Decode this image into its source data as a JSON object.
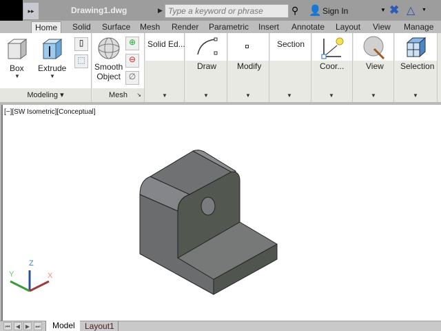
{
  "titlebar": {
    "title": "Drawing1.dwg",
    "search_placeholder": "Type a keyword or phrase",
    "sign_in": "Sign In"
  },
  "tabs": [
    "Home",
    "Solid",
    "Surface",
    "Mesh",
    "Render",
    "Parametric",
    "Insert",
    "Annotate",
    "Layout",
    "View",
    "Manage"
  ],
  "ribbon": {
    "box": "Box",
    "extrude": "Extrude",
    "smooth1": "Smooth",
    "smooth2": "Object",
    "modeling": "Modeling",
    "mesh": "Mesh",
    "solid_edit": "Solid Ed...",
    "draw": "Draw",
    "modify": "Modify",
    "section": "Section",
    "coordinates": "Coor...",
    "view": "View",
    "selection": "Selection"
  },
  "viewport": {
    "label": "[−][SW Isometric][Conceptual]",
    "axis_x": "X",
    "axis_y": "Y",
    "axis_z": "Z"
  },
  "layout_tabs": [
    "Model",
    "Layout1"
  ],
  "colors": {
    "accent": "#3a6fc4"
  }
}
